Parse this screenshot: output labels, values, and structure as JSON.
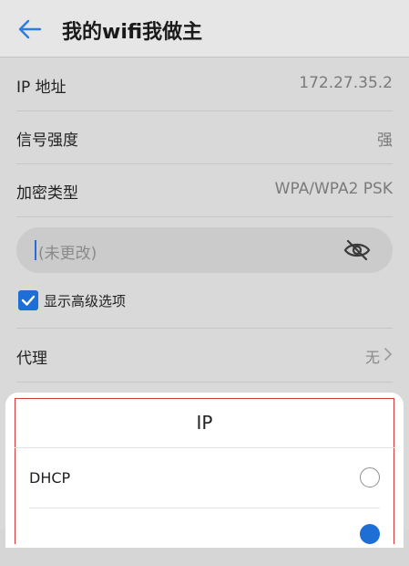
{
  "header": {
    "title": "我的wifi我做主"
  },
  "info_rows": [
    {
      "label": "IP 地址",
      "value": "172.27.35.2"
    },
    {
      "label": "信号强度",
      "value": "强"
    },
    {
      "label": "加密类型",
      "value": "WPA/WPA2 PSK"
    }
  ],
  "password": {
    "placeholder": "(未更改)"
  },
  "advanced": {
    "label": "显示高级选项",
    "checked": true
  },
  "proxy": {
    "label": "代理",
    "value": "无"
  },
  "ip_sheet": {
    "title": "IP",
    "options": [
      {
        "label": "DHCP",
        "selected": false
      },
      {
        "label": "",
        "selected": true
      }
    ]
  },
  "colors": {
    "accent": "#1d6fd6",
    "highlight_frame": "#d23c3c"
  }
}
